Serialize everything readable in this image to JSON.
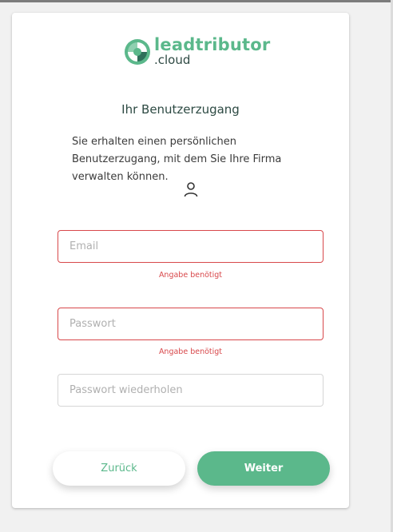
{
  "brand": {
    "name": "leadtributor",
    "suffix": ".cloud",
    "color": "#5bb88b"
  },
  "heading": "Ihr Benutzerzugang",
  "description": "Sie erhalten einen persönlichen Benutzerzugang, mit dem Sie Ihre Firma verwalten können.",
  "icons": {
    "user": "user-icon",
    "logo": "leadtributor-logo-icon"
  },
  "form": {
    "email": {
      "placeholder": "Email",
      "value": "",
      "error": "Angabe benötigt"
    },
    "password": {
      "placeholder": "Passwort",
      "value": "",
      "error": "Angabe benötigt"
    },
    "password_repeat": {
      "placeholder": "Passwort wiederholen",
      "value": ""
    }
  },
  "buttons": {
    "back": "Zurück",
    "next": "Weiter"
  },
  "colors": {
    "accent": "#5bb88b",
    "error": "#d8484b"
  }
}
